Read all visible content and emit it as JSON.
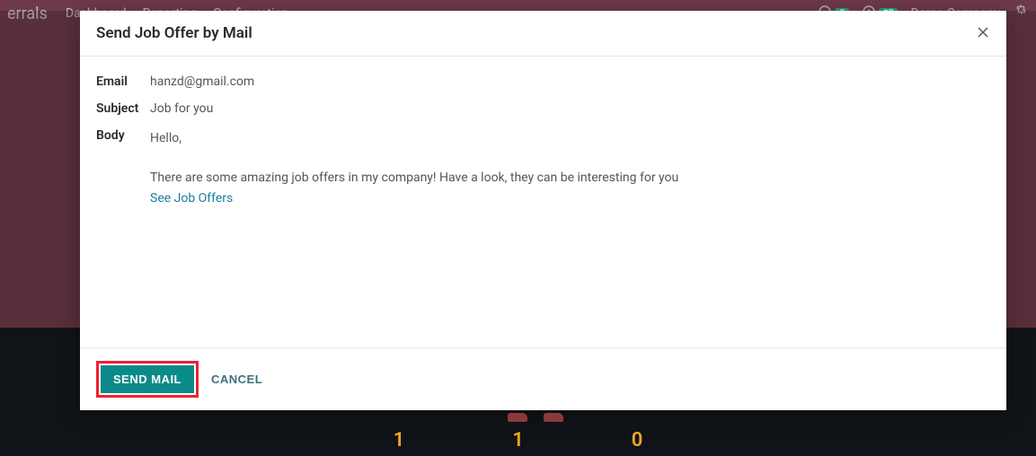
{
  "navbar": {
    "brand": "errals",
    "links": [
      "Dashboard",
      "Reporting",
      "Configuration"
    ],
    "badge1_count": "5",
    "badge2_count": "37",
    "company": "Demo Company"
  },
  "modal": {
    "title": "Send Job Offer by Mail",
    "email_label": "Email",
    "email_value": "hanzd@gmail.com",
    "subject_label": "Subject",
    "subject_value": "Job for you",
    "body_label": "Body",
    "body_line1": "Hello,",
    "body_line2": "There are some amazing job offers in my company! Have a look, they can be interesting for you",
    "body_link": "See Job Offers",
    "send_label": "SEND MAIL",
    "cancel_label": "CANCEL"
  },
  "footer_nums": [
    "1",
    "1",
    "0"
  ]
}
